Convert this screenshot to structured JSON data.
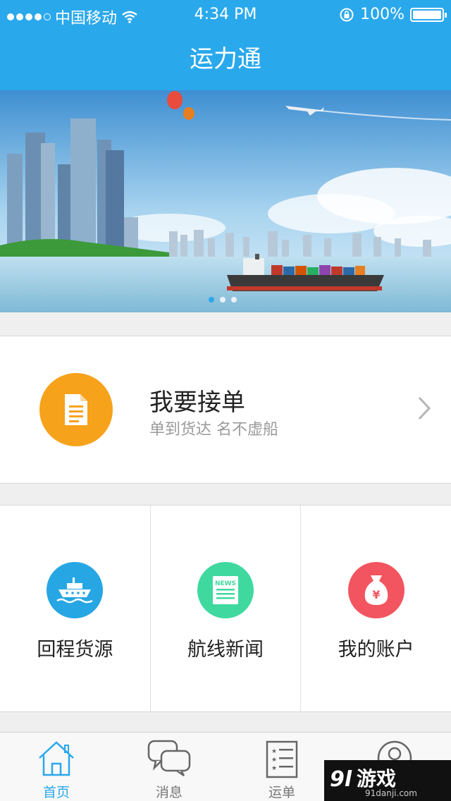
{
  "status_bar": {
    "carrier": "中国移动",
    "time": "4:34 PM",
    "battery_text": "100%",
    "battery_level": 1.0,
    "signal_bars": 4,
    "icons": [
      "signal-icon",
      "wifi-icon",
      "rotation-lock-icon",
      "battery-icon"
    ]
  },
  "nav": {
    "title": "运力通"
  },
  "banner": {
    "page_count": 3,
    "active_page": 0
  },
  "order_card": {
    "title": "我要接单",
    "subtitle": "单到货达 名不虚船",
    "icon": "document-icon",
    "icon_color": "#f7a21b"
  },
  "features": [
    {
      "label": "回程货源",
      "icon": "ship-icon",
      "color": "#27a6e4"
    },
    {
      "label": "航线新闻",
      "icon": "news-icon",
      "color": "#3fd9a0"
    },
    {
      "label": "我的账户",
      "icon": "money-bag-icon",
      "color": "#f2555f"
    }
  ],
  "tabs": [
    {
      "label": "首页",
      "icon": "home-icon"
    },
    {
      "label": "消息",
      "icon": "chat-icon"
    },
    {
      "label": "运单",
      "icon": "list-icon"
    },
    {
      "label": "",
      "icon": "user-icon"
    }
  ],
  "active_tab": 0,
  "accent_color": "#2aa8ec",
  "watermark": {
    "text": "游戏",
    "logo": "9l",
    "url": "91danji.com"
  }
}
